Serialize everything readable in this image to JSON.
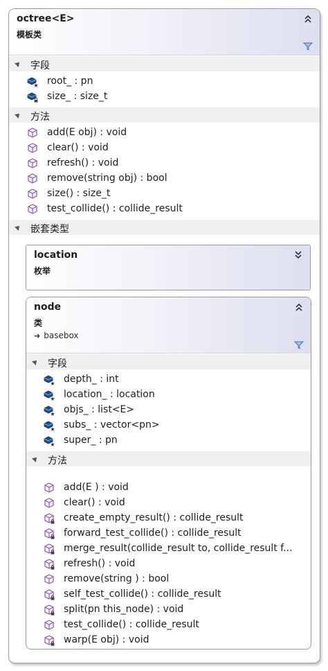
{
  "octree": {
    "title": "octree<E>",
    "kind": "模板类",
    "fields_label": "字段",
    "fields": [
      "root_ : pn",
      "size_ : size_t"
    ],
    "methods_label": "方法",
    "methods": [
      "add(E obj) : void",
      "clear() : void",
      "refresh() : void",
      "remove(string obj) : bool",
      "size() : size_t",
      "test_collide() : collide_result"
    ],
    "nested_label": "嵌套类型"
  },
  "location": {
    "title": "location",
    "kind": "枚举"
  },
  "node": {
    "title": "node",
    "kind": "类",
    "base": "basebox",
    "fields_label": "字段",
    "fields": [
      "depth_ : int",
      "location_ : location",
      "objs_ : list<E>",
      "subs_ : vector<pn>",
      "super_ : pn"
    ],
    "methods_label": "方法",
    "methods": [
      "add(E ) : void",
      "clear() : void",
      "create_empty_result() : collide_result",
      "forward_test_collide() : collide_result",
      "merge_result(collide_result to, collide_result f...",
      "refresh() : void",
      "remove(string ) : bool",
      "self_test_collide() : collide_result",
      "split(pn this_node) : void",
      "test_collide() : collide_result",
      "warp(E obj) : void"
    ]
  },
  "colors": {
    "member_icon": "#8a5aa8",
    "field_icon": "#1f4e8c",
    "lock": "#444444"
  }
}
